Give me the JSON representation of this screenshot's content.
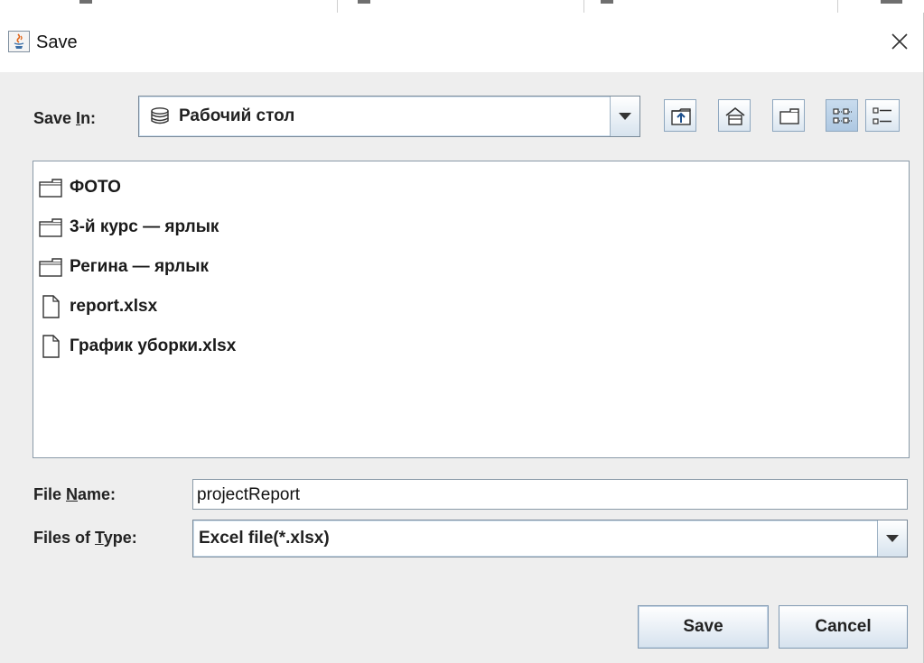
{
  "window": {
    "title": "Save"
  },
  "save_in": {
    "label_pre": "Save ",
    "label_mnemonic": "I",
    "label_post": "n:",
    "value": "Рабочий стол"
  },
  "toolbar": {
    "buttons": [
      "up-one-level-icon",
      "home-icon",
      "new-folder-icon",
      "list-view-icon",
      "details-view-icon"
    ]
  },
  "files": [
    {
      "name": "ФОТО",
      "type": "folder"
    },
    {
      "name": "3-й курс — ярлык",
      "type": "folder"
    },
    {
      "name": "Регина — ярлык",
      "type": "folder"
    },
    {
      "name": "report.xlsx",
      "type": "file"
    },
    {
      "name": "График уборки.xlsx",
      "type": "file"
    }
  ],
  "file_name": {
    "label_pre": "File ",
    "label_mnemonic": "N",
    "label_post": "ame:",
    "value": "projectReport"
  },
  "file_type": {
    "label_pre": "Files of ",
    "label_mnemonic": "T",
    "label_post": "ype:",
    "value": "Excel file(*.xlsx)"
  },
  "buttons": {
    "save": "Save",
    "cancel": "Cancel"
  },
  "colors": {
    "accent": "#d7e3ee",
    "border": "#7a8a99",
    "selected_view": "#aec8e2"
  }
}
